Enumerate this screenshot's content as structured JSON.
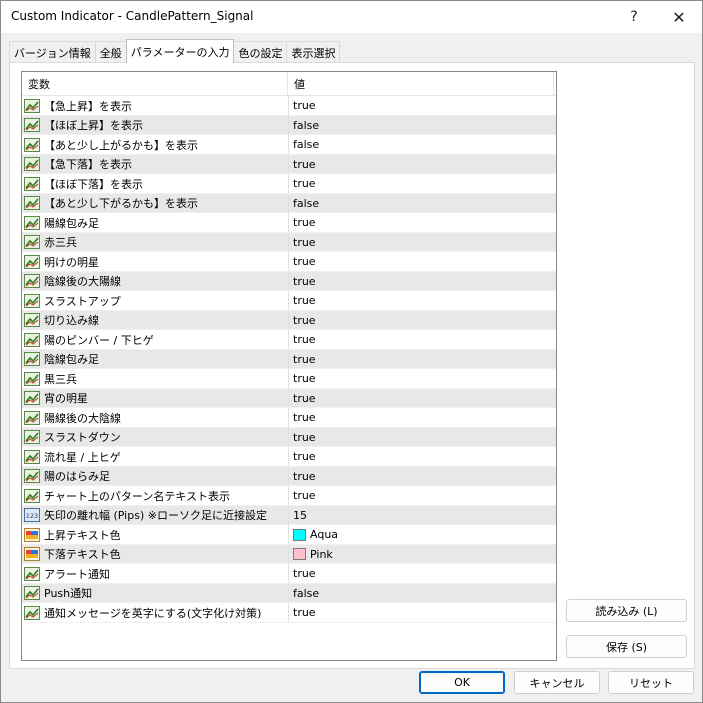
{
  "window": {
    "title": "Custom Indicator - CandlePattern_Signal",
    "help_label": "?",
    "close_label": "✕"
  },
  "tabs": [
    {
      "label": "バージョン情報"
    },
    {
      "label": "全般"
    },
    {
      "label": "パラメーターの入力"
    },
    {
      "label": "色の設定"
    },
    {
      "label": "表示選択"
    }
  ],
  "grid": {
    "header_variable": "変数",
    "header_value": "値",
    "rows": [
      {
        "name": "【急上昇】を表示",
        "value": "true",
        "icon": "bool-icon"
      },
      {
        "name": "【ほぼ上昇】を表示",
        "value": "false",
        "icon": "bool-icon"
      },
      {
        "name": "【あと少し上がるかも】を表示",
        "value": "false",
        "icon": "bool-icon"
      },
      {
        "name": "【急下落】を表示",
        "value": "true",
        "icon": "bool-icon"
      },
      {
        "name": "【ほぼ下落】を表示",
        "value": "true",
        "icon": "bool-icon"
      },
      {
        "name": "【あと少し下がるかも】を表示",
        "value": "false",
        "icon": "bool-icon"
      },
      {
        "name": "陽線包み足",
        "value": "true",
        "icon": "bool-icon"
      },
      {
        "name": "赤三兵",
        "value": "true",
        "icon": "bool-icon"
      },
      {
        "name": "明けの明星",
        "value": "true",
        "icon": "bool-icon"
      },
      {
        "name": "陰線後の大陽線",
        "value": "true",
        "icon": "bool-icon"
      },
      {
        "name": "スラストアップ",
        "value": "true",
        "icon": "bool-icon"
      },
      {
        "name": "切り込み線",
        "value": "true",
        "icon": "bool-icon"
      },
      {
        "name": "陽のピンバー / 下ヒゲ",
        "value": "true",
        "icon": "bool-icon"
      },
      {
        "name": "陰線包み足",
        "value": "true",
        "icon": "bool-icon"
      },
      {
        "name": "黒三兵",
        "value": "true",
        "icon": "bool-icon"
      },
      {
        "name": "宵の明星",
        "value": "true",
        "icon": "bool-icon"
      },
      {
        "name": "陽線後の大陰線",
        "value": "true",
        "icon": "bool-icon"
      },
      {
        "name": "スラストダウン",
        "value": "true",
        "icon": "bool-icon"
      },
      {
        "name": "流れ星 / 上ヒゲ",
        "value": "true",
        "icon": "bool-icon"
      },
      {
        "name": "陽のはらみ足",
        "value": "true",
        "icon": "bool-icon"
      },
      {
        "name": "チャート上のパターン名テキスト表示",
        "value": "true",
        "icon": "bool-icon"
      },
      {
        "name": "矢印の離れ幅 (Pips) ※ローソク足に近接設定",
        "value": "15",
        "icon": "number-icon"
      },
      {
        "name": "上昇テキスト色",
        "value": "Aqua",
        "icon": "color-icon",
        "swatch": "#00ffff"
      },
      {
        "name": "下落テキスト色",
        "value": "Pink",
        "icon": "color-icon",
        "swatch": "#ffc0cb"
      },
      {
        "name": "アラート通知",
        "value": "true",
        "icon": "bool-icon"
      },
      {
        "name": "Push通知",
        "value": "false",
        "icon": "bool-icon"
      },
      {
        "name": "通知メッセージを英字にする(文字化け対策)",
        "value": "true",
        "icon": "bool-icon"
      }
    ]
  },
  "buttons": {
    "load": "読み込み (L)",
    "save": "保存 (S)",
    "ok": "OK",
    "cancel": "キャンセル",
    "reset": "リセット"
  },
  "colors": {
    "accent": "#0067c0",
    "row_alt": "#e8e8e8"
  }
}
